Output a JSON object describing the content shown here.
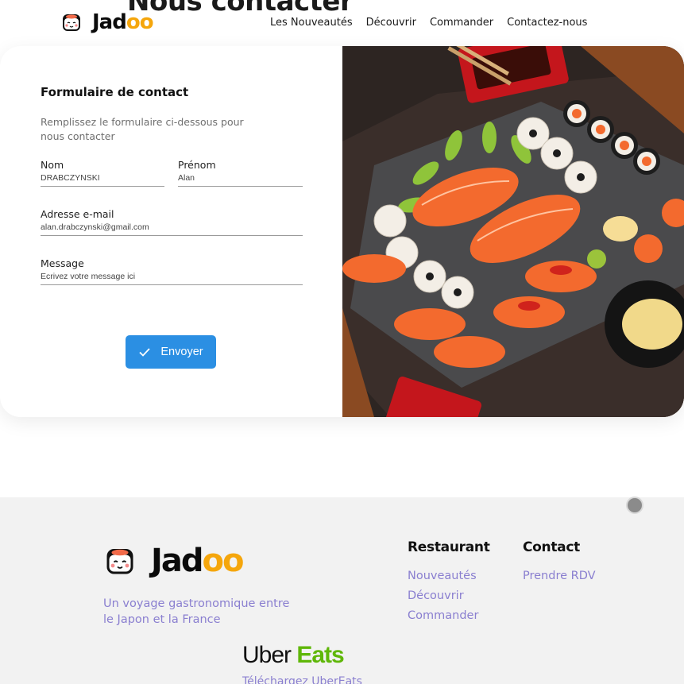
{
  "header": {
    "cut_heading": "Nous contacter",
    "brand": {
      "name_main": "Jad",
      "name_accent": "oo"
    },
    "nav": [
      "Les Nouveautés",
      "Découvrir",
      "Commander",
      "Contactez-nous"
    ]
  },
  "form": {
    "title": "Formulaire de contact",
    "subtitle": "Remplissez le formulaire ci-dessous pour nous contacter",
    "nom": {
      "label": "Nom",
      "value": "DRABCZYNSKI"
    },
    "prenom": {
      "label": "Prénom",
      "value": "Alan"
    },
    "email": {
      "label": "Adresse e-mail",
      "value": "alan.drabczynski@gmail.com"
    },
    "message": {
      "label": "Message",
      "placeholder": "Ecrivez votre message ici"
    },
    "submit_label": "Envoyer"
  },
  "footer": {
    "brand": {
      "name_main": "Jad",
      "name_accent": "oo"
    },
    "tagline": "Un voyage gastronomique entre le Japon et la France",
    "restaurant": {
      "heading": "Restaurant",
      "links": [
        "Nouveautés",
        "Découvrir",
        "Commander"
      ]
    },
    "contact": {
      "heading": "Contact",
      "links": [
        "Prendre RDV"
      ]
    },
    "uber": {
      "uber": "Uber ",
      "eats": "Eats",
      "download": "Téléchargez UberEats"
    }
  },
  "colors": {
    "accent_blue": "#2b8fe3",
    "link_purple": "#8a7fd0",
    "brand_yellow": "#f5a60c",
    "uber_green": "#5fb709"
  }
}
